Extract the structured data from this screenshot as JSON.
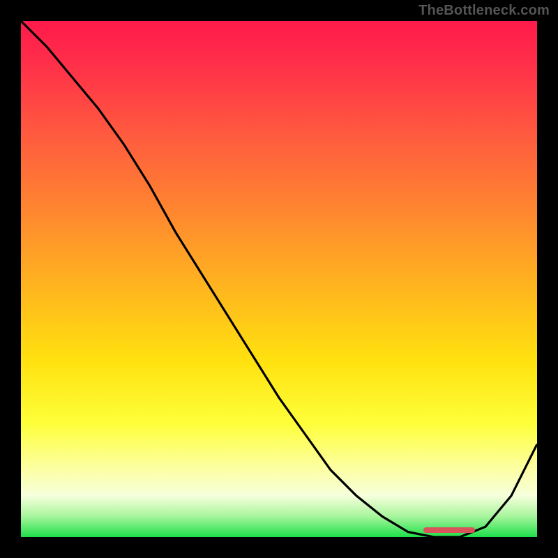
{
  "attribution": "TheBottleneck.com",
  "colors": {
    "line": "#000000",
    "marker": "#d9535a",
    "gradient_top": "#ff1a4b",
    "gradient_bottom": "#1ee04a"
  },
  "chart_data": {
    "type": "line",
    "title": "",
    "xlabel": "",
    "ylabel": "",
    "xlim": [
      0,
      100
    ],
    "ylim": [
      0,
      100
    ],
    "x": [
      0,
      5,
      10,
      15,
      20,
      25,
      30,
      35,
      40,
      45,
      50,
      55,
      60,
      65,
      70,
      75,
      80,
      85,
      90,
      95,
      100
    ],
    "values": [
      100,
      95,
      89,
      83,
      76,
      68,
      59,
      51,
      43,
      35,
      27,
      20,
      13,
      8,
      4,
      1,
      0,
      0,
      2,
      8,
      18
    ],
    "marker_range_x": [
      78,
      88
    ],
    "annotations": []
  }
}
